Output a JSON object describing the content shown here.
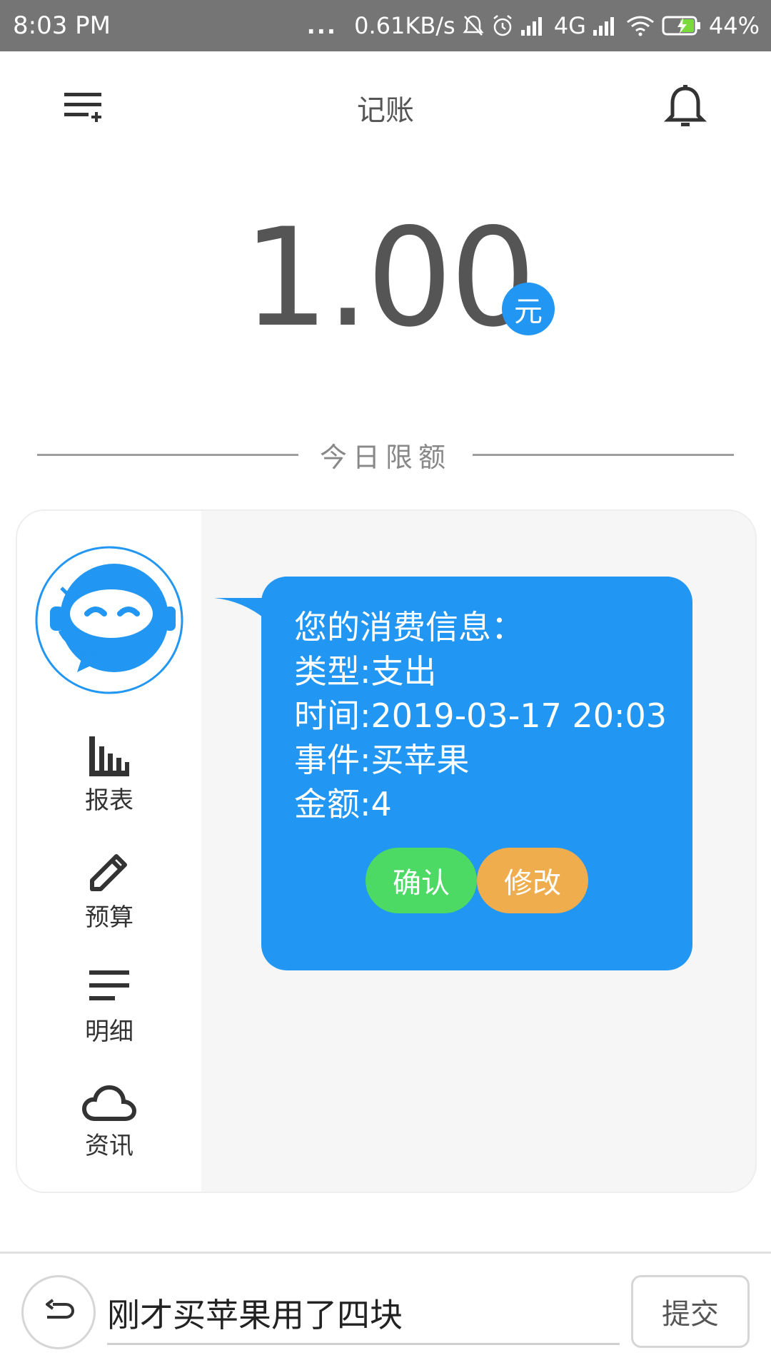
{
  "status_bar": {
    "time": "8:03 PM",
    "dots": "...",
    "net_speed": "0.61KB/s",
    "network": "4G",
    "battery": "44%",
    "icons": [
      "mute-icon",
      "alarm-icon",
      "signal-icon",
      "wifi-icon",
      "battery-charging-icon"
    ]
  },
  "app_bar": {
    "title": "记账",
    "left_icon": "menu-add-icon",
    "right_icon": "bell-icon"
  },
  "amount": {
    "value": "1.00",
    "currency": "元"
  },
  "limit_label": "今日限额",
  "sidebar": {
    "items": [
      {
        "label": "报表",
        "icon": "bar-chart-icon"
      },
      {
        "label": "预算",
        "icon": "pencil-icon"
      },
      {
        "label": "明细",
        "icon": "list-icon"
      },
      {
        "label": "资讯",
        "icon": "cloud-icon"
      }
    ]
  },
  "message": {
    "lines": [
      "您的消费信息：",
      "类型:支出",
      "时间:2019-03-17 20:03",
      "事件:买苹果",
      "金额:4"
    ],
    "confirm_label": "确认",
    "modify_label": "修改"
  },
  "input_bar": {
    "value": "刚才买苹果用了四块",
    "submit_label": "提交"
  },
  "colors": {
    "accent": "#2196F3",
    "confirm": "#4CD964",
    "modify": "#F0AD4E",
    "status_bar": "#757575"
  }
}
